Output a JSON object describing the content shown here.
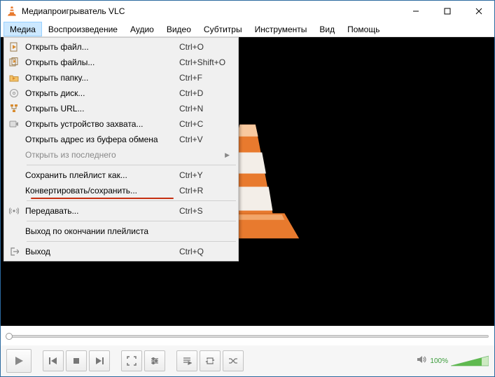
{
  "title": "Медиапроигрыватель VLC",
  "menus": [
    "Медиа",
    "Воспроизведение",
    "Аудио",
    "Видео",
    "Субтитры",
    "Инструменты",
    "Вид",
    "Помощь"
  ],
  "dropdown": {
    "groups": [
      [
        {
          "icon": "file-play",
          "label": "Открыть файл...",
          "shortcut": "Ctrl+O"
        },
        {
          "icon": "files-play",
          "label": "Открыть файлы...",
          "shortcut": "Ctrl+Shift+O"
        },
        {
          "icon": "folder",
          "label": "Открыть папку...",
          "shortcut": "Ctrl+F"
        },
        {
          "icon": "disc",
          "label": "Открыть диск...",
          "shortcut": "Ctrl+D"
        },
        {
          "icon": "network",
          "label": "Открыть URL...",
          "shortcut": "Ctrl+N"
        },
        {
          "icon": "capture",
          "label": "Открыть устройство захвата...",
          "shortcut": "Ctrl+C"
        },
        {
          "icon": "",
          "label": "Открыть адрес из буфера обмена",
          "shortcut": "Ctrl+V"
        },
        {
          "icon": "",
          "label": "Открыть из последнего",
          "shortcut": "",
          "disabled": true,
          "arrow": true
        }
      ],
      [
        {
          "icon": "",
          "label": "Сохранить плейлист как...",
          "shortcut": "Ctrl+Y"
        },
        {
          "icon": "",
          "label": "Конвертировать/сохранить...",
          "shortcut": "Ctrl+R",
          "underline": true
        }
      ],
      [
        {
          "icon": "stream",
          "label": "Передавать...",
          "shortcut": "Ctrl+S"
        }
      ],
      [
        {
          "icon": "",
          "label": "Выход по окончании плейлиста",
          "shortcut": ""
        }
      ],
      [
        {
          "icon": "exit",
          "label": "Выход",
          "shortcut": "Ctrl+Q"
        }
      ]
    ]
  },
  "volume": "100%"
}
